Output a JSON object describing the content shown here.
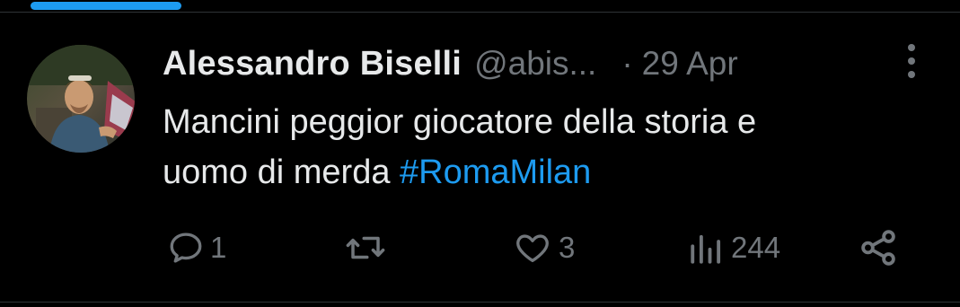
{
  "tweet": {
    "author_name": "Alessandro Biselli",
    "author_handle": "@abis...",
    "separator": "·",
    "date": "29 Apr",
    "text_line1": "Mancini peggior giocatore della storia e",
    "text_line2_plain": "uomo di merda ",
    "hashtag": "#RomaMilan"
  },
  "actions": {
    "reply_count": "1",
    "retweet_count": "",
    "like_count": "3",
    "views_count": "244"
  },
  "icons": {
    "reply": "reply-icon",
    "retweet": "retweet-icon",
    "like": "heart-icon",
    "views": "views-chart-icon",
    "share": "share-icon",
    "more": "more-vertical-icon"
  },
  "colors": {
    "background": "#000000",
    "text": "#e7e9ea",
    "secondary": "#71767b",
    "accent": "#1d9bf0",
    "divider": "#2f3336"
  }
}
